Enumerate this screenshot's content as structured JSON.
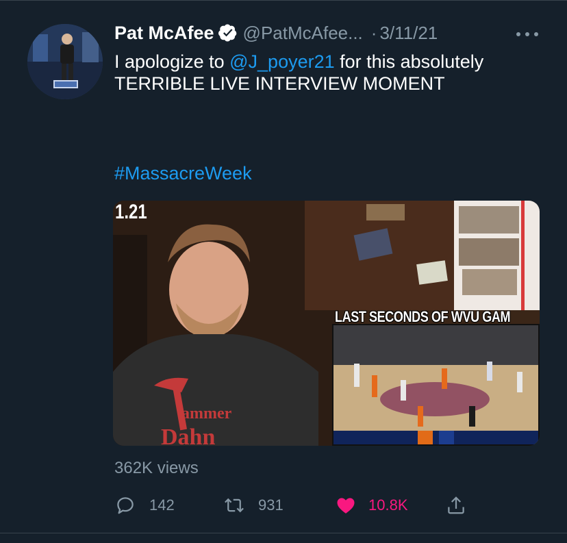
{
  "tweet": {
    "author_name": "Pat McAfee",
    "author_handle": "@PatMcAfee...",
    "separator": "·",
    "date": "3/11/21",
    "text_before": "I apologize to ",
    "mention": "@J_poyer21",
    "text_after": " for this absolutely TERRIBLE LIVE INTERVIEW MOMENT",
    "hashtag": "#MassacreWeek",
    "media_overlay_text": "LAST SECONDS OF WVU GAM",
    "media_counter": "1.21",
    "views": "362K views"
  },
  "actions": {
    "reply_count": "142",
    "retweet_count": "931",
    "like_count": "10.8K"
  },
  "icons": {
    "verified": "verified-badge-icon",
    "more": "more-dots-icon",
    "reply": "reply-icon",
    "retweet": "retweet-icon",
    "like": "heart-icon",
    "share": "share-icon"
  },
  "colors": {
    "background": "#15202b",
    "link": "#1d9bf0",
    "secondary_text": "#8899a6",
    "like": "#f91880"
  }
}
